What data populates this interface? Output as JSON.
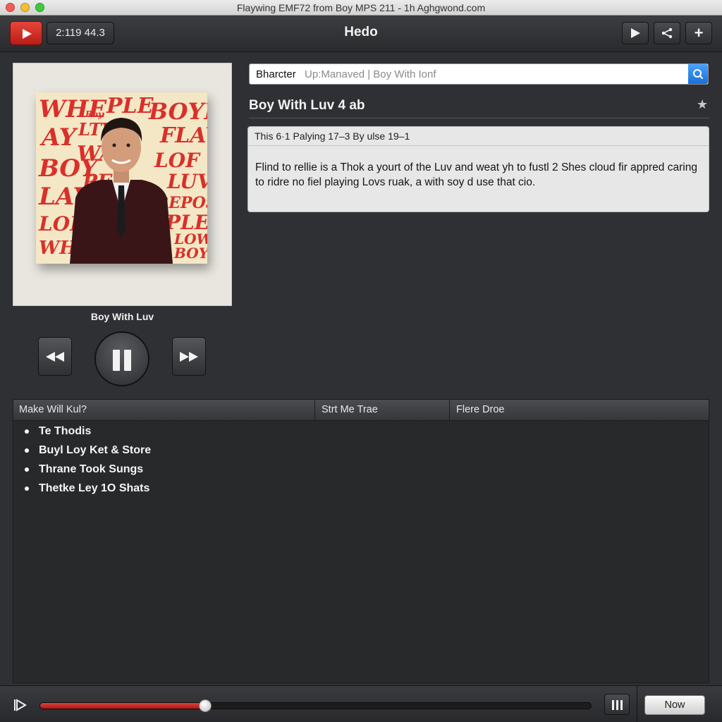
{
  "window": {
    "title": "Flaywing EMF72 from Boy MPS 211 - 1h Aghgwond.com"
  },
  "toolbar": {
    "time": "2:119 44.3",
    "app_title": "Hedo"
  },
  "album": {
    "caption": "Boy With Luv",
    "cover_words": [
      "WHE",
      "PLE",
      "BOYE",
      "AY",
      "LTY",
      "FLAY",
      "BOY",
      "WA",
      "LOF",
      "LAY",
      "PE",
      "LUV",
      "REPOS",
      "LOFE",
      "PLE",
      "WHL",
      "LOW",
      "BOY",
      "Roy"
    ]
  },
  "search": {
    "value": "Bharcter",
    "placeholder": "Up:Manaved | Boy With Ionf"
  },
  "song": {
    "title": "Boy With Luv 4 ab"
  },
  "info": {
    "header": "This 6·1 Palying 17–3 By ulse 19–1",
    "body": "Flind to rellie is a Thok a yourt of the Luv and weat yh to fustl 2 Shes cloud fir appred caring to ridre no fiel playing Lovs ruak, a with soy d use that cio."
  },
  "table": {
    "columns": [
      "Make Will Kul?",
      "Strt Me Trae",
      "Flere Droe"
    ],
    "rows": [
      "Te Thodis",
      "Buyl Loy Ket & Store",
      "Thrane Took Sungs",
      "Thetke Ley 1O Shats"
    ]
  },
  "player": {
    "progress": 0.3,
    "now_label": "Now"
  },
  "colors": {
    "accent_red": "#d9302a",
    "search_blue": "#1a6fd6"
  }
}
